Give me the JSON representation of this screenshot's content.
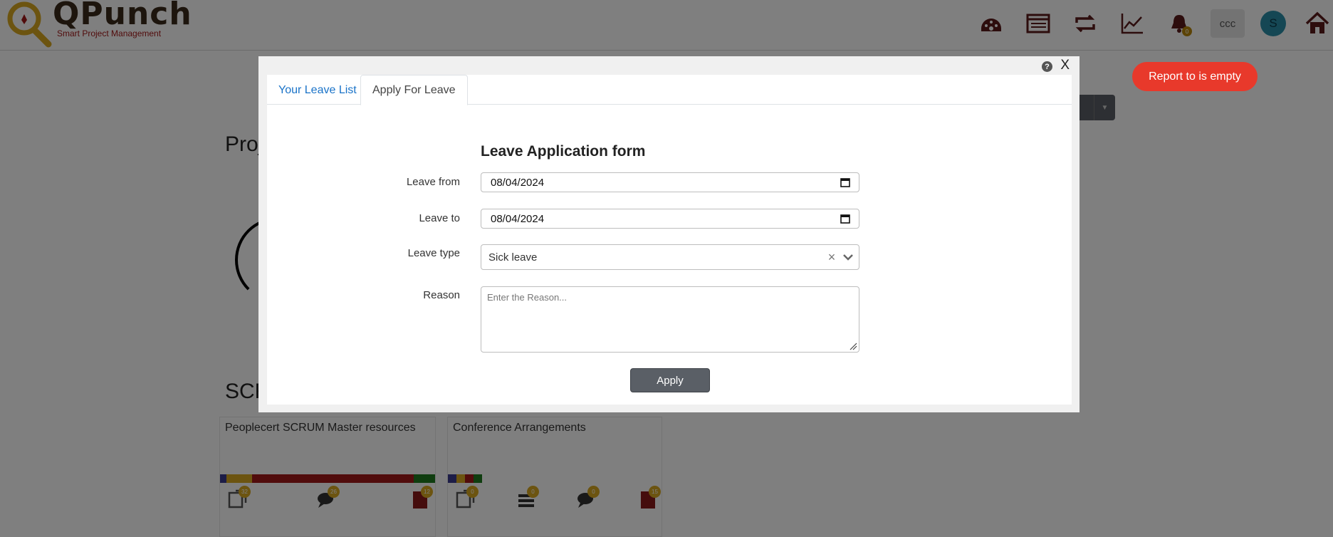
{
  "app": {
    "logo_title": "QPunch",
    "logo_subtitle": "Smart Project Management"
  },
  "header": {
    "icons": [
      "dashboard-icon",
      "list-icon",
      "repeat-icon",
      "chart-line-icon",
      "bell-icon",
      "home-icon"
    ],
    "notification_count": "0",
    "chip_label": "ccc",
    "avatar_initial": "S"
  },
  "background": {
    "section_1_title": "Proj",
    "section_2_title": "SCR",
    "cards": [
      {
        "name": "Peoplecert SCRUM Master resources",
        "badges": [
          "32",
          "26",
          "12"
        ]
      },
      {
        "name": "Conference Arrangements",
        "badges": [
          "0",
          "0",
          "0",
          "15"
        ]
      }
    ]
  },
  "modal": {
    "close_label": "X",
    "help_label": "?",
    "tabs": [
      {
        "label": "Your Leave List",
        "active": false
      },
      {
        "label": "Apply For Leave",
        "active": true
      }
    ],
    "form": {
      "title": "Leave Application form",
      "leave_from_label": "Leave from",
      "leave_from_value": "08/04/2024",
      "leave_to_label": "Leave to",
      "leave_to_value": "08/04/2024",
      "leave_type_label": "Leave type",
      "leave_type_value": "Sick leave",
      "reason_label": "Reason",
      "reason_placeholder": "Enter the Reason...",
      "apply_label": "Apply"
    }
  },
  "toast": {
    "message": "Report to is empty",
    "color": "#e8392b"
  }
}
